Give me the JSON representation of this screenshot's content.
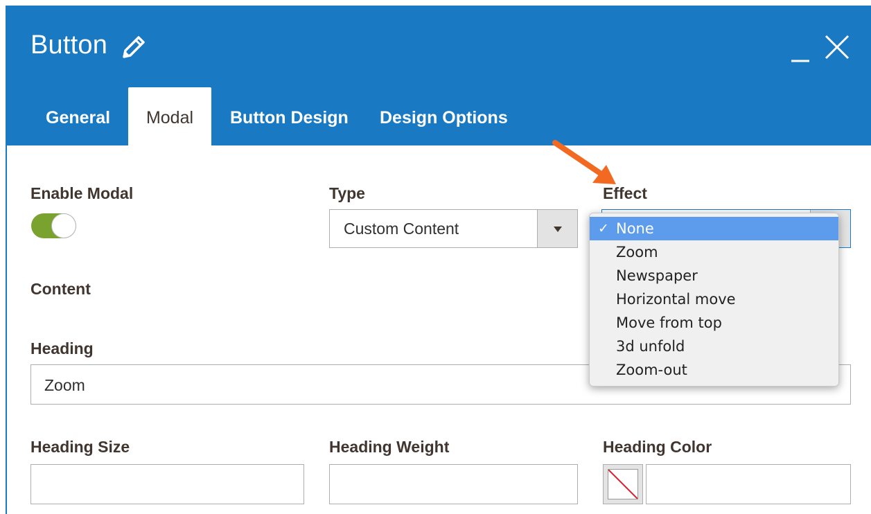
{
  "window": {
    "title": "Button",
    "title_icon": "pencil-icon",
    "controls": {
      "minimize_icon": "minimize-icon",
      "close_icon": "close-icon"
    },
    "header_color": "#1979c3"
  },
  "tabs": [
    {
      "label": "General",
      "active": false
    },
    {
      "label": "Modal",
      "active": true
    },
    {
      "label": "Button Design",
      "active": false
    },
    {
      "label": "Design Options",
      "active": false
    }
  ],
  "form": {
    "enable_modal": {
      "label": "Enable Modal",
      "value": true,
      "color": "#79a22e"
    },
    "type": {
      "label": "Type",
      "value": "Custom Content"
    },
    "effect": {
      "label": "Effect",
      "value": "None",
      "options": [
        "None",
        "Zoom",
        "Newspaper",
        "Horizontal move",
        "Move from top",
        "3d unfold",
        "Zoom-out"
      ],
      "selected_index": 0
    },
    "content": {
      "label": "Content"
    },
    "heading": {
      "label": "Heading",
      "value": "Zoom"
    },
    "heading_size": {
      "label": "Heading Size",
      "value": ""
    },
    "heading_weight": {
      "label": "Heading Weight",
      "value": ""
    },
    "heading_color": {
      "label": "Heading Color",
      "value": ""
    }
  },
  "annotation": {
    "arrow_color": "#f26a21",
    "points_to": "effect"
  }
}
